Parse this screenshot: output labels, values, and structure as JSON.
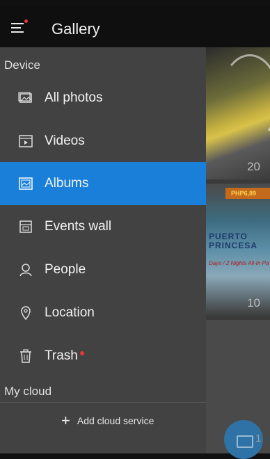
{
  "app": {
    "title": "Gallery"
  },
  "drawer": {
    "sections": [
      {
        "header": "Device"
      },
      {
        "header": "My cloud"
      }
    ],
    "items": [
      {
        "label": "All photos",
        "icon": "photos-icon",
        "active": false
      },
      {
        "label": "Videos",
        "icon": "video-icon",
        "active": false
      },
      {
        "label": "Albums",
        "icon": "albums-icon",
        "active": true
      },
      {
        "label": "Events wall",
        "icon": "events-wall-icon",
        "active": false
      },
      {
        "label": "People",
        "icon": "people-icon",
        "active": false
      },
      {
        "label": "Location",
        "icon": "location-pin-icon",
        "active": false
      },
      {
        "label": "Trash",
        "icon": "trash-icon",
        "active": false
      }
    ],
    "add_cloud": "Add cloud service"
  },
  "background": {
    "thumbnails": [
      {
        "count": "20"
      },
      {
        "count": "10",
        "banner": "PHP6,89",
        "promo": "PUERTO PRINCESA",
        "tag": "Days / 2 Nights All-In Pa"
      }
    ],
    "partial_count": "1"
  },
  "colors": {
    "accent": "#1a7fd8",
    "drawer_bg": "#424242",
    "topbar_bg": "#0f0f0f",
    "notification_dot": "#e53935",
    "fab": "#2f73a6"
  }
}
